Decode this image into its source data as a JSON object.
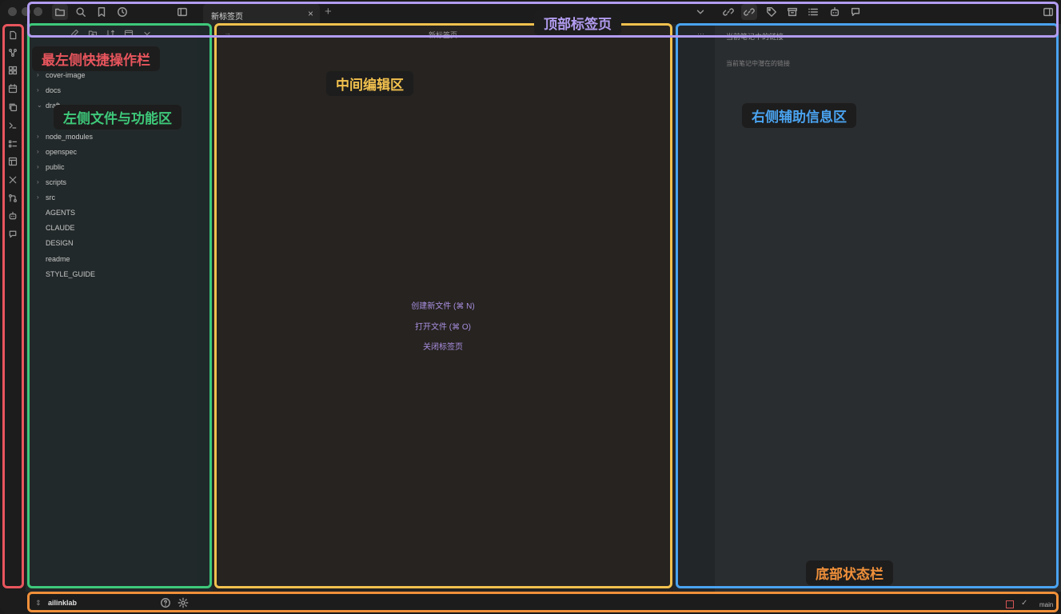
{
  "colors": {
    "ribbon_annotation": "#e8555d",
    "left_annotation": "#3ec97a",
    "editor_annotation": "#f2c14e",
    "right_annotation": "#4aa3f0",
    "top_annotation": "#b29cf0",
    "status_annotation": "#f0903a",
    "editor_bg": "#262320",
    "accent": "#a98fe0"
  },
  "annotations": {
    "ribbon": "最左侧快捷操作栏",
    "left": "左侧文件与功能区",
    "editor": "中间编辑区",
    "right": "右侧辅助信息区",
    "top": "顶部标签页",
    "status": "底部状态栏"
  },
  "tabbar": {
    "active_tab": "新标签页",
    "close": "×",
    "new_tab": "+"
  },
  "explorer": {
    "items": [
      {
        "name": "cover-image",
        "folder": true
      },
      {
        "name": "docs",
        "folder": true
      },
      {
        "name": "draft",
        "folder": true,
        "open": true
      },
      {
        "name": "node_modules",
        "folder": true
      },
      {
        "name": "openspec",
        "folder": true
      },
      {
        "name": "public",
        "folder": true
      },
      {
        "name": "scripts",
        "folder": true
      },
      {
        "name": "src",
        "folder": true
      },
      {
        "name": "AGENTS",
        "folder": false
      },
      {
        "name": "CLAUDE",
        "folder": false
      },
      {
        "name": "DESIGN",
        "folder": false
      },
      {
        "name": "readme",
        "folder": false
      },
      {
        "name": "STYLE_GUIDE",
        "folder": false
      }
    ]
  },
  "editor": {
    "title": "新标签页",
    "actions": [
      "创建新文件 (⌘ N)",
      "打开文件 (⌘ O)",
      "关闭标签页"
    ]
  },
  "right_panel": {
    "heading": "当前笔记中的链接",
    "subtitle": "当前笔记中潜在的链接"
  },
  "status": {
    "vault": "ailinklab",
    "branch": "main"
  }
}
